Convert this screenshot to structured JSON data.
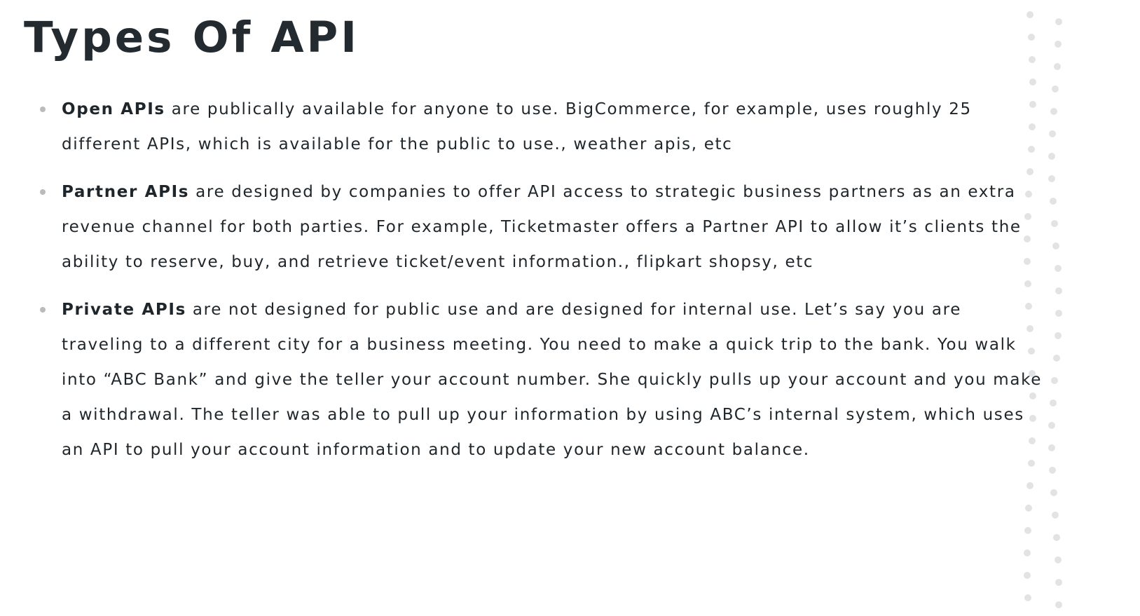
{
  "slide": {
    "title": "Types Of API",
    "bullets": [
      {
        "term": "Open APIs",
        "text": " are publically available for anyone to use. BigCommerce, for example, uses roughly 25 different APIs, which is available for the public to use., weather apis, etc"
      },
      {
        "term": "Partner APIs",
        "text": " are designed by companies to offer API access to strategic business partners as an extra revenue channel for both parties. For example, Ticketmaster offers a Partner API to allow it’s clients the ability to reserve, buy, and retrieve ticket/event information., flipkart shopsy, etc"
      },
      {
        "term": "Private APIs",
        "text": " are not designed for public use and are designed for internal use. Let’s say you are traveling to a different city for a business meeting. You need to make a quick trip to the bank. You walk into “ABC Bank” and give the teller your account number. She quickly pulls up your account and you make a withdrawal. The teller was able to pull up your information by using ABC’s internal system, which uses an API to pull your account information and to update your new account balance."
      }
    ]
  },
  "colors": {
    "title": "#232b31",
    "body_text": "#1f262b",
    "bullet_dot": "#b9bcbf",
    "decoration_dots": "#e1e3e5",
    "background": "#ffffff"
  }
}
